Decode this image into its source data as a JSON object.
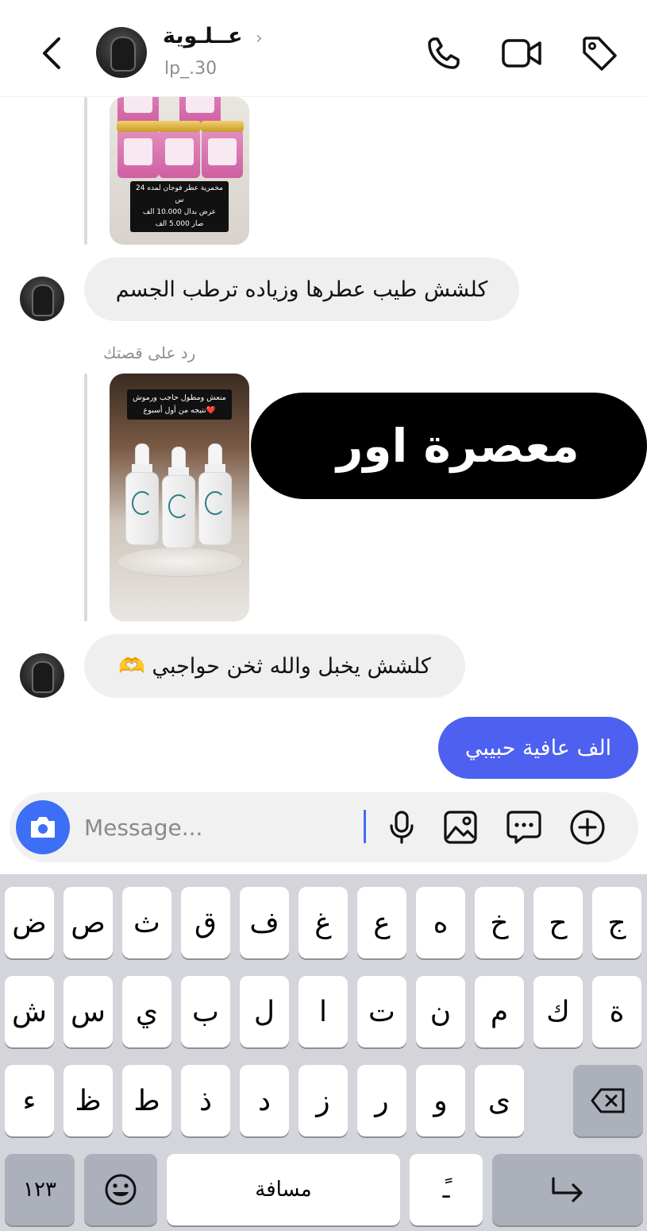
{
  "header": {
    "name": "عــلـوية",
    "username": "lp_.30"
  },
  "stories": {
    "first_caption": [
      "مخمرية عطر فوجان لمده 24 س",
      "عرض بدال 10.000 الف",
      "صار 5.000 الف"
    ],
    "second_caption": [
      "منعش ومطول حاجب ورموش",
      "نتيجه من أول أسبوع❤️"
    ]
  },
  "messages": [
    {
      "from": "them",
      "text": "كلشش طيب عطرها وزياده ترطب الجسم"
    },
    {
      "from": "them",
      "reply_label": "رد على قصتك",
      "text": "معصرة اور"
    },
    {
      "from": "them",
      "text": "كلشش يخبل والله ثخن حواجبي 🫶"
    },
    {
      "from": "me",
      "text": "الف عافية حبيبي"
    }
  ],
  "composer": {
    "placeholder": "Message..."
  },
  "keyboard": {
    "row1": [
      "ج",
      "ح",
      "خ",
      "ه",
      "ع",
      "غ",
      "ف",
      "ق",
      "ث",
      "ص",
      "ض"
    ],
    "row2": [
      "ة",
      "ك",
      "م",
      "ن",
      "ت",
      "ا",
      "ل",
      "ب",
      "ي",
      "س",
      "ش"
    ],
    "row3": [
      "ى",
      "و",
      "ر",
      "ز",
      "د",
      "ذ",
      "ط",
      "ظ",
      "ء"
    ],
    "numbers_label": "١٢٣",
    "space_label": "مسافة",
    "diacritic_label": "ًـ"
  },
  "colors": {
    "accent": "#3d6ef6",
    "outgoing_bubble": "#4e60f0",
    "incoming_bubble": "#efefef"
  }
}
